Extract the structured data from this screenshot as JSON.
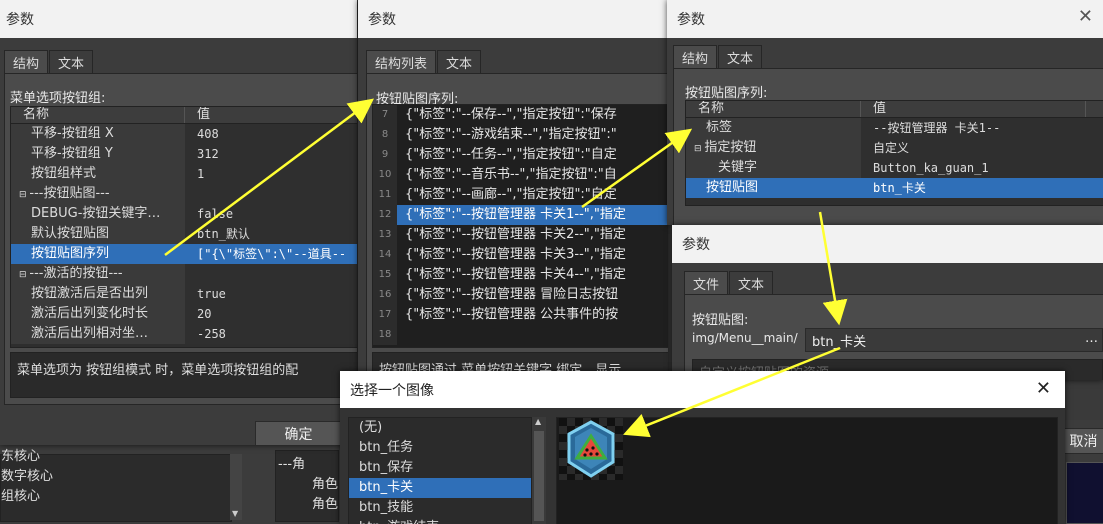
{
  "bg": {
    "left_items": [
      "东核心",
      "数字核心",
      "组核心"
    ],
    "mid_items": [
      "---角",
      "角色",
      "角色"
    ],
    "right_btn": "取消"
  },
  "w1": {
    "title": "参数",
    "tabs": [
      "结构",
      "文本"
    ],
    "section_label": "菜单选项按钮组:",
    "col_name": "名称",
    "col_value": "值",
    "rows": [
      {
        "name": "平移-按钮组 X",
        "value": "408"
      },
      {
        "name": "平移-按钮组 Y",
        "value": "312"
      },
      {
        "name": "按钮组样式",
        "value": "1"
      },
      {
        "name": "---按钮贴图---",
        "value": "",
        "group": true
      },
      {
        "name": "DEBUG-按钮关键字…",
        "value": "false"
      },
      {
        "name": "默认按钮贴图",
        "value": "btn_默认"
      },
      {
        "name": "按钮贴图序列",
        "value": "[\"{\\\"标签\\\":\\\"--道具--",
        "selected": true
      },
      {
        "name": "---激活的按钮---",
        "value": "",
        "group": true
      },
      {
        "name": "按钮激活后是否出列",
        "value": "true"
      },
      {
        "name": "激活后出列变化时长",
        "value": "20"
      },
      {
        "name": "激活后出列相对坐…",
        "value": "-258"
      }
    ],
    "description": "菜单选项为 按钮组模式 时，菜单选项按钮组的配",
    "ok_button": "确定"
  },
  "w2": {
    "title": "参数",
    "tabs": [
      "结构列表",
      "文本"
    ],
    "section_label": "按钮贴图序列:",
    "lines": [
      {
        "no": "7",
        "text": "{\"标签\":\"--保存--\",\"指定按钮\":\"保存"
      },
      {
        "no": "8",
        "text": "{\"标签\":\"--游戏结束--\",\"指定按钮\":\""
      },
      {
        "no": "9",
        "text": "{\"标签\":\"--任务--\",\"指定按钮\":\"自定"
      },
      {
        "no": "10",
        "text": "{\"标签\":\"--音乐书--\",\"指定按钮\":\"自"
      },
      {
        "no": "11",
        "text": "{\"标签\":\"--画廊--\",\"指定按钮\":\"自定"
      },
      {
        "no": "12",
        "text": "{\"标签\":\"--按钮管理器 卡关1--\",\"指定",
        "selected": true
      },
      {
        "no": "13",
        "text": "{\"标签\":\"--按钮管理器 卡关2--\",\"指定"
      },
      {
        "no": "14",
        "text": "{\"标签\":\"--按钮管理器 卡关3--\",\"指定"
      },
      {
        "no": "15",
        "text": "{\"标签\":\"--按钮管理器 卡关4--\",\"指定"
      },
      {
        "no": "16",
        "text": "{\"标签\":\"--按钮管理器 冒险日志按钮"
      },
      {
        "no": "17",
        "text": "{\"标签\":\"--按钮管理器 公共事件的按"
      },
      {
        "no": "18",
        "text": ""
      }
    ],
    "description": "按钮贴图通过 菜单按钮关键字 绑定，显示"
  },
  "w3": {
    "title": "参数",
    "tabs": [
      "结构",
      "文本"
    ],
    "section_label": "按钮贴图序列:",
    "col_name": "名称",
    "col_value": "值",
    "rows": [
      {
        "name": "标签",
        "value": "--按钮管理器 卡关1--"
      },
      {
        "name": "指定按钮",
        "value": "自定义",
        "group": true
      },
      {
        "name": "关键字",
        "value": "Button_ka_guan_1",
        "indent": true
      },
      {
        "name": "按钮贴图",
        "value": "btn_卡关",
        "selected": true
      }
    ]
  },
  "w4": {
    "title": "参数",
    "tabs": [
      "文件",
      "文本"
    ],
    "section_label": "按钮贴图:",
    "path": "img/Menu__main/",
    "file_value": "btn_卡关",
    "more": "…",
    "hint": "自定义按钮贴图的资源"
  },
  "w5": {
    "title": "选择一个图像",
    "items": [
      "(无)",
      "btn_任务",
      "btn_保存",
      "btn_卡关",
      "btn_技能",
      "btn_游戏结束"
    ],
    "selected_index": 3
  },
  "colors": {
    "selection": "#2f6fb8",
    "arrow": "#ffff33"
  }
}
